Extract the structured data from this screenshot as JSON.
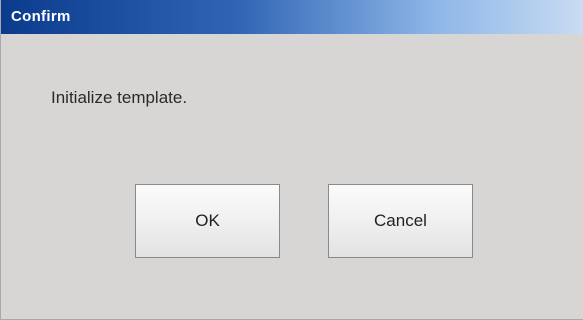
{
  "dialog": {
    "title": "Confirm",
    "message": "Initialize template.",
    "ok_label": "OK",
    "cancel_label": "Cancel"
  }
}
